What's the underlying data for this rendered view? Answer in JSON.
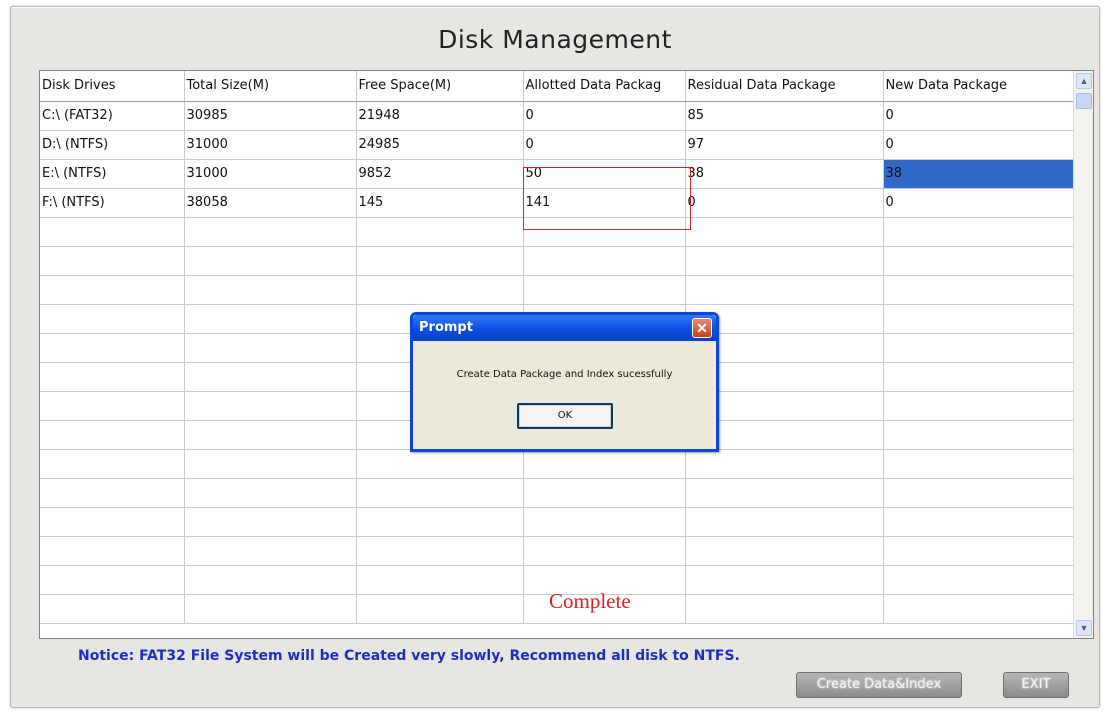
{
  "window": {
    "title": "Disk Management"
  },
  "grid": {
    "columns": [
      "Disk Drives",
      "Total Size(M)",
      "Free Space(M)",
      "Allotted Data Packag",
      "Residual Data Package",
      "New Data Package"
    ],
    "rows": [
      [
        "C:\\ (FAT32)",
        "30985",
        "21948",
        "0",
        "85",
        "0"
      ],
      [
        "D:\\ (NTFS)",
        "31000",
        "24985",
        "0",
        "97",
        "0"
      ],
      [
        "E:\\ (NTFS)",
        "31000",
        "9852",
        "50",
        "38",
        "38"
      ],
      [
        "F:\\ (NTFS)",
        "38058",
        "145",
        "141",
        "0",
        "0"
      ]
    ],
    "selected_cell": {
      "row": 2,
      "column": 5
    }
  },
  "annotation": {
    "complete_label": "Complete",
    "color": "#e02020"
  },
  "notice": "Notice:  FAT32 File System will be Created very slowly, Recommend all disk to NTFS.",
  "buttons": {
    "create_label": "Create Data&Index",
    "exit_label": "EXIT"
  },
  "dialog": {
    "title": "Prompt",
    "message": "Create Data Package and Index sucessfully",
    "ok_label": "OK",
    "close_icon": "close-icon"
  },
  "colors": {
    "selection": "#3169c6",
    "notice_text": "#1a2fc2",
    "dialog_titlebar": "#0a4ee0"
  }
}
